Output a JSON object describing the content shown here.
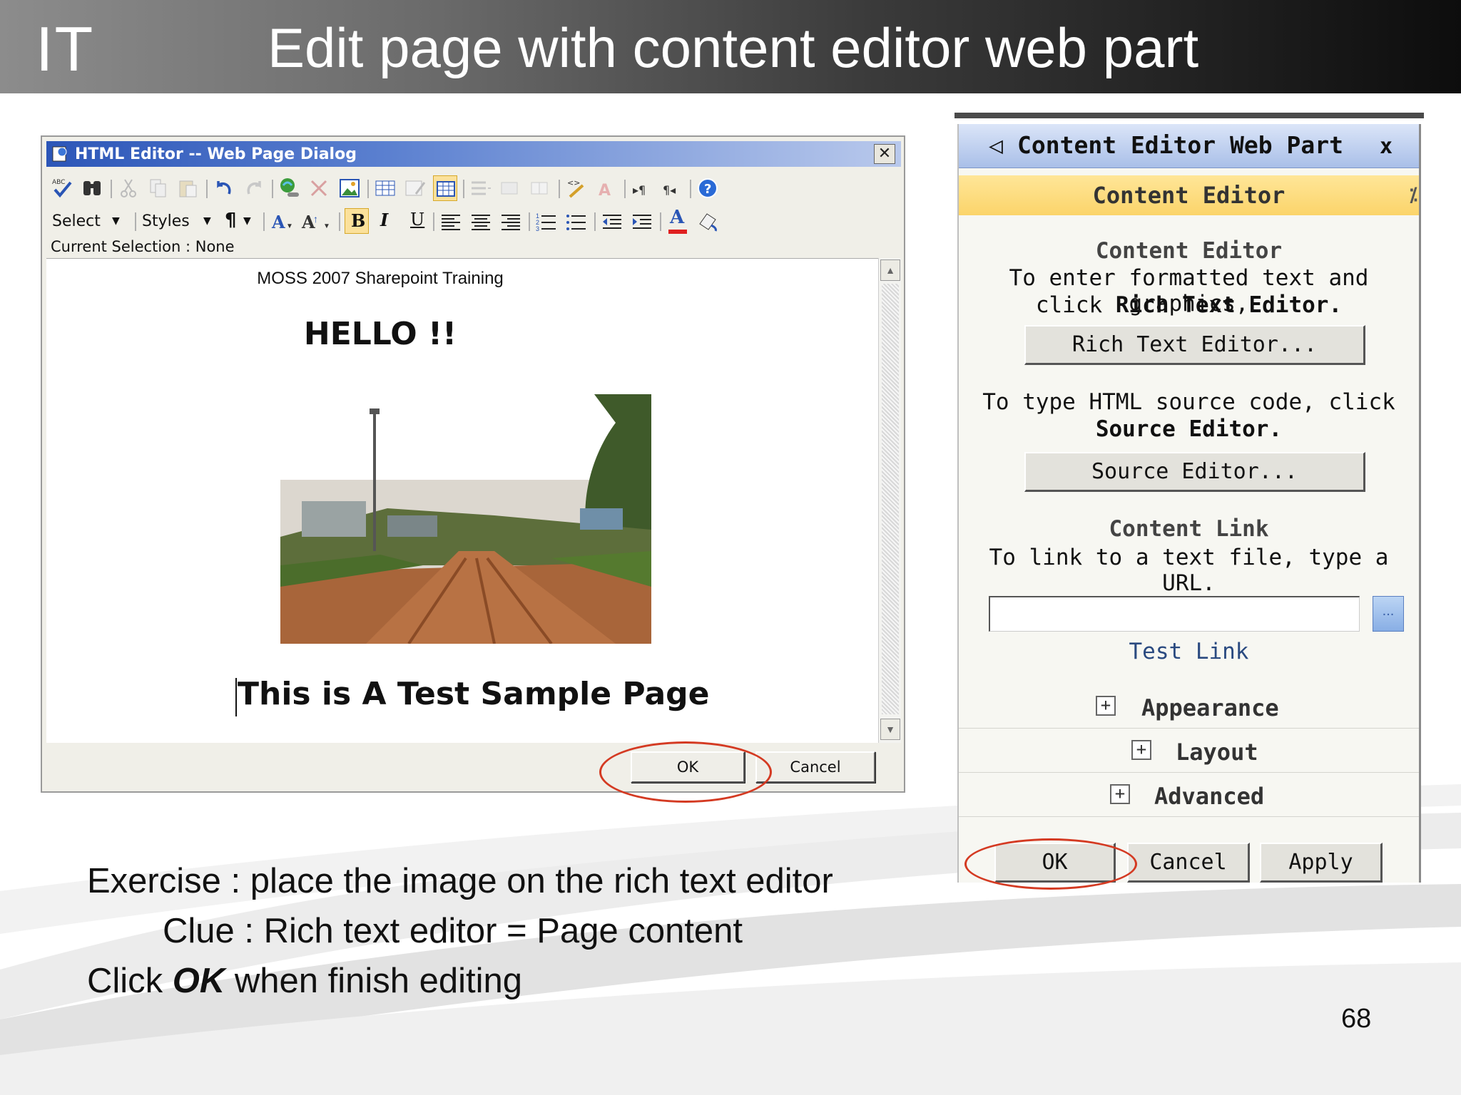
{
  "slide": {
    "brand": "IT",
    "title": "Edit page with content editor web part",
    "page_number": "68"
  },
  "html_editor": {
    "window_title": "HTML Editor -- Web Page Dialog",
    "close_label": "✕",
    "toolbar": {
      "select_label": "Select",
      "styles_label": "Styles",
      "paragraph_label": "¶",
      "bold_label": "B",
      "italic_label": "I",
      "underline_label": "U",
      "font_color_label": "A"
    },
    "current_selection": "Current Selection : None",
    "content": {
      "subtitle": "MOSS 2007 Sharepoint Training",
      "heading": "HELLO !!",
      "body": "This is A Test Sample Page"
    },
    "ok_label": "OK",
    "cancel_label": "Cancel"
  },
  "web_part": {
    "header": "Content Editor Web Part",
    "close_label": "x",
    "section_title": "Content Editor",
    "content_editor_heading": "Content Editor",
    "rich_text_line1": "To enter formatted text and graphics,",
    "rich_text_line2_prefix": "click ",
    "rich_text_line2_bold": "Rich Text Editor.",
    "rich_text_button": "Rich Text Editor...",
    "source_line1": "To type HTML source code, click",
    "source_line2_bold": "Source Editor.",
    "source_button": "Source Editor...",
    "content_link_heading": "Content Link",
    "content_link_text": "To link to a text file, type a URL.",
    "url_value": "",
    "browse_label": "...",
    "test_link": "Test Link",
    "sections": [
      "Appearance",
      "Layout",
      "Advanced"
    ],
    "ok_label": "OK",
    "cancel_label": "Cancel",
    "apply_label": "Apply"
  },
  "instructions": {
    "line1": "Exercise : place the image on the rich text editor",
    "line2": "Clue : Rich text editor = Page content",
    "line3_prefix": "Click ",
    "line3_bold": "OK",
    "line3_suffix": " when finish editing"
  },
  "colors": {
    "highlight_ellipse": "#d43a22",
    "dialog_title_blue": "#2c56b8",
    "web_part_header": "#a9bfe8",
    "section_yellow": "#fbd46a"
  }
}
